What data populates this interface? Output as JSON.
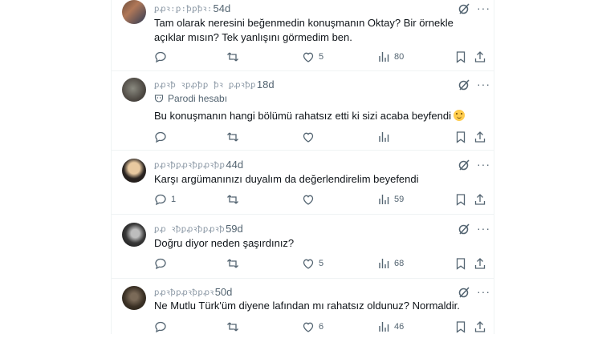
{
  "tweets": [
    {
      "handle": "ꝑꝓꝛ꞉ꝑ꞉ꝥꝑꝥꝛ꞉",
      "time": "54d",
      "text": "Tam olarak neresini beğenmedin konuşmanın Oktay? Bir örnekle açıklar mısın? Tek yanlışını görmedim ben.",
      "reply_count": "",
      "retweet_count": "",
      "like_count": "5",
      "view_count": "80"
    },
    {
      "handle": "ꝑꝓꝛꝥ ꝛꝑꝓꝥꝑ ꝥꝛ ꝑꝓꝛꝥꝑ",
      "time": "18d",
      "badge": "Parodi hesabı",
      "text": "Bu konuşmanın hangi bölümü rahatsız etti ki sizi acaba beyfendi",
      "reply_count": "",
      "retweet_count": "",
      "like_count": "",
      "view_count": ""
    },
    {
      "handle": "ꝑꝓꝛꝥꝑꝓꝛꝥꝑꝓꝛꝥꝑ",
      "time": "44d",
      "text": "Karşı argümanınızı duyalım da değerlendirelim beyefendi",
      "reply_count": "1",
      "retweet_count": "",
      "like_count": "",
      "view_count": "59"
    },
    {
      "handle": "ꝑꝓ ꝛꝥꝑꝓꝛꝥꝑꝓꝛꝥ",
      "time": "59d",
      "text": "Doğru diyor neden şaşırdınız?",
      "reply_count": "",
      "retweet_count": "",
      "like_count": "5",
      "view_count": "68"
    },
    {
      "handle": "ꝑꝓꝛꝥꝑꝓꝛꝥꝑꝓꝛ",
      "time": "50d",
      "text": "Ne Mutlu Türk'üm diyene lafından mı rahatsız oldunuz? Normaldir.",
      "reply_count": "",
      "retweet_count": "",
      "like_count": "6",
      "view_count": "46"
    }
  ],
  "colors": {
    "text": "#0f1419",
    "muted": "#536471",
    "border": "#eff3f4"
  },
  "icons": [
    "reply-icon",
    "retweet-icon",
    "like-icon",
    "views-icon",
    "bookmark-icon",
    "share-icon",
    "grok-icon",
    "more-icon"
  ]
}
